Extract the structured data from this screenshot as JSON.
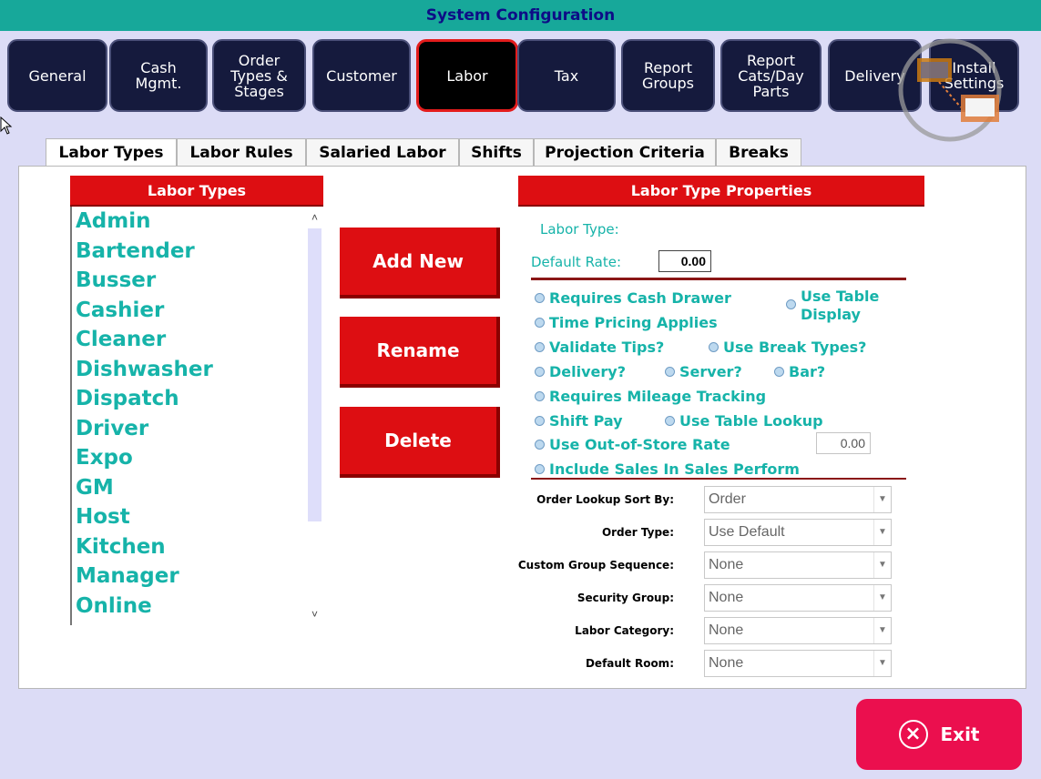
{
  "window": {
    "title": "System Configuration"
  },
  "top_nav": [
    "General",
    "Cash\nMgmt.",
    "Order\nTypes &\nStages",
    "Customer",
    "Labor",
    "Tax",
    "Report\nGroups",
    "Report\nCats/Day\nParts",
    "Delivery",
    "Install\nSettings"
  ],
  "active_top": "Labor",
  "tabs": [
    "Labor Types",
    "Labor Rules",
    "Salaried Labor",
    "Shifts",
    "Projection Criteria",
    "Breaks"
  ],
  "active_tab": "Labor Types",
  "labor_types": {
    "header": "Labor Types",
    "items": [
      "Admin",
      "Bartender",
      "Busser",
      "Cashier",
      "Cleaner",
      "Dishwasher",
      "Dispatch",
      "Driver",
      "Expo",
      "GM",
      "Host",
      "Kitchen",
      "Manager",
      "Online"
    ]
  },
  "actions": {
    "add": "Add New",
    "rename": "Rename",
    "delete": "Delete"
  },
  "properties": {
    "header": "Labor Type Properties",
    "labor_type_label": "Labor Type:",
    "default_rate_label": "Default Rate:",
    "default_rate_value": "0.00",
    "options": {
      "requires_cash_drawer": "Requires Cash Drawer",
      "use_table_display": "Use Table\nDisplay",
      "time_pricing": "Time Pricing Applies",
      "validate_tips": "Validate Tips?",
      "use_break_types": "Use Break Types?",
      "delivery": "Delivery?",
      "server": "Server?",
      "bar": "Bar?",
      "mileage": "Requires Mileage Tracking",
      "shift_pay": "Shift Pay",
      "table_lookup": "Use Table Lookup",
      "out_of_store": "Use Out-of-Store Rate",
      "include_sales": "Include Sales In Sales Perform"
    },
    "out_of_store_value": "0.00",
    "fields": [
      {
        "label": "Order Lookup Sort By:",
        "value": "Order"
      },
      {
        "label": "Order Type:",
        "value": "Use Default"
      },
      {
        "label": "Custom Group Sequence:",
        "value": "None"
      },
      {
        "label": "Security Group:",
        "value": "None"
      },
      {
        "label": "Labor Category:",
        "value": "None"
      },
      {
        "label": "Default Room:",
        "value": "None"
      }
    ]
  },
  "exit_label": "Exit",
  "colors": {
    "titlebar": "#17a89a",
    "accent_red": "#dd0e12",
    "teal_text": "#16b3a9",
    "nav_button": "#151a3d",
    "exit": "#eb0f4e"
  }
}
